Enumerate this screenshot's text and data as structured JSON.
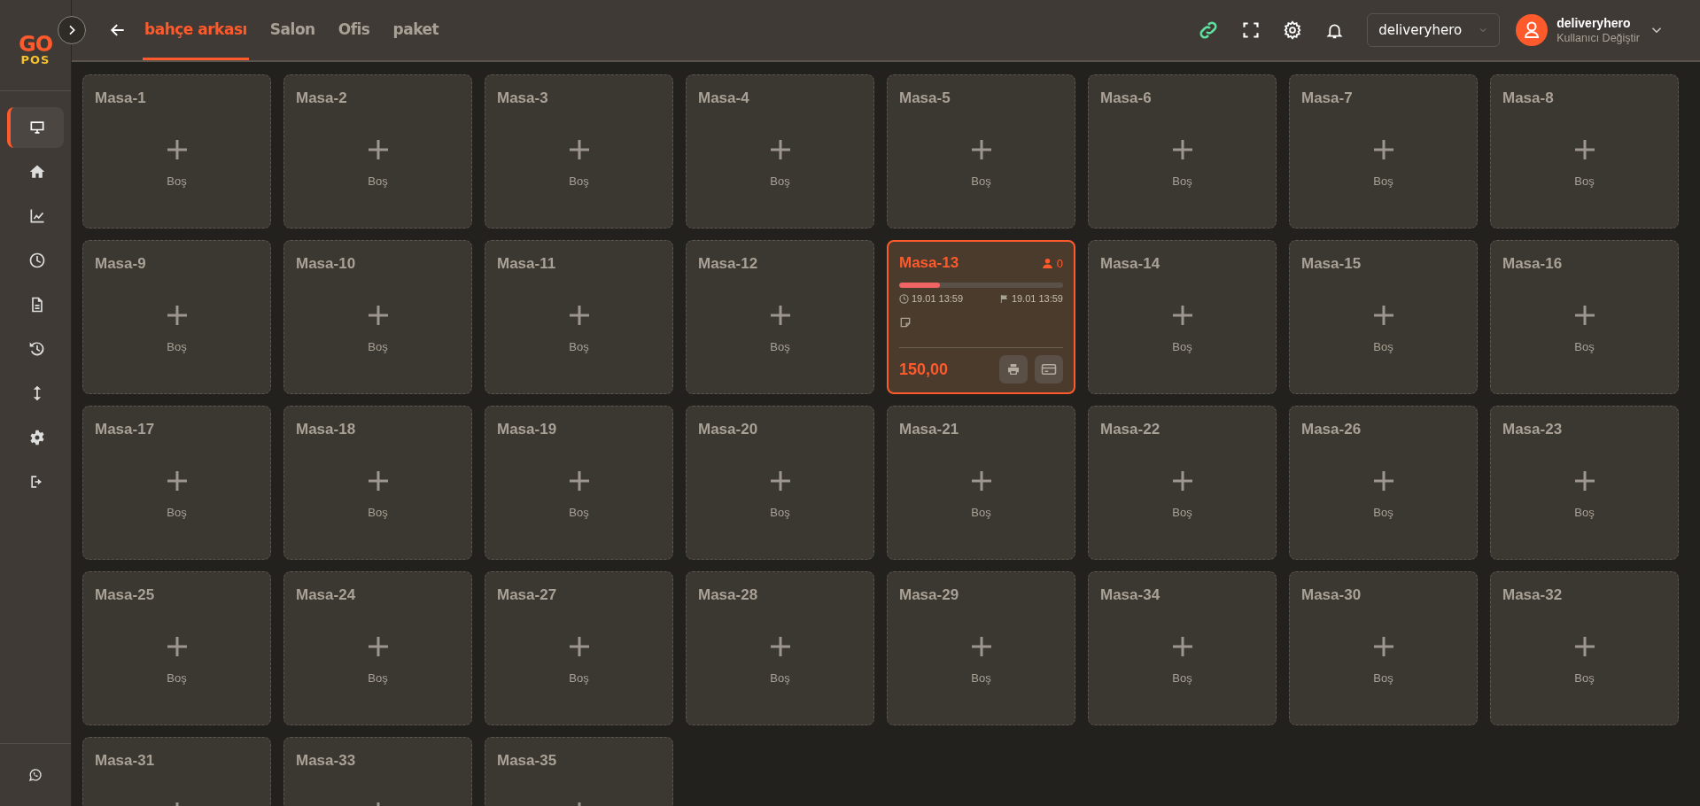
{
  "logo": {
    "top": "GO",
    "bottom": "POS"
  },
  "tabs": [
    {
      "label": "bahçe arkası",
      "selected": true
    },
    {
      "label": "Salon",
      "selected": false
    },
    {
      "label": "Ofis",
      "selected": false
    },
    {
      "label": "paket",
      "selected": false
    }
  ],
  "header": {
    "branch_select": "deliveryhero",
    "user": {
      "name": "deliveryhero",
      "subtitle": "Kullanıcı Değiştir"
    }
  },
  "sidebar": {
    "items": [
      {
        "kind": "monitor",
        "selected": true
      },
      {
        "kind": "home",
        "selected": false
      },
      {
        "kind": "chart",
        "selected": false
      },
      {
        "kind": "clock",
        "selected": false
      },
      {
        "kind": "document",
        "selected": false
      },
      {
        "kind": "history",
        "selected": false
      },
      {
        "kind": "updown",
        "selected": false
      },
      {
        "kind": "gear",
        "selected": false
      },
      {
        "kind": "logout",
        "selected": false
      }
    ]
  },
  "tables": [
    {
      "kind": "empty",
      "name": "Masa-1",
      "status": "Boş"
    },
    {
      "kind": "empty",
      "name": "Masa-2",
      "status": "Boş"
    },
    {
      "kind": "empty",
      "name": "Masa-3",
      "status": "Boş"
    },
    {
      "kind": "empty",
      "name": "Masa-4",
      "status": "Boş"
    },
    {
      "kind": "empty",
      "name": "Masa-5",
      "status": "Boş"
    },
    {
      "kind": "empty",
      "name": "Masa-6",
      "status": "Boş"
    },
    {
      "kind": "empty",
      "name": "Masa-7",
      "status": "Boş"
    },
    {
      "kind": "empty",
      "name": "Masa-8",
      "status": "Boş"
    },
    {
      "kind": "empty",
      "name": "Masa-9",
      "status": "Boş"
    },
    {
      "kind": "empty",
      "name": "Masa-10",
      "status": "Boş"
    },
    {
      "kind": "empty",
      "name": "Masa-11",
      "status": "Boş"
    },
    {
      "kind": "empty",
      "name": "Masa-12",
      "status": "Boş"
    },
    {
      "kind": "occupied",
      "name": "Masa-13",
      "guests": "0",
      "level": 0.25,
      "opened": "19.01 13:59",
      "target": "19.01 13:59",
      "total": "150,00"
    },
    {
      "kind": "empty",
      "name": "Masa-14",
      "status": "Boş"
    },
    {
      "kind": "empty",
      "name": "Masa-15",
      "status": "Boş"
    },
    {
      "kind": "empty",
      "name": "Masa-16",
      "status": "Boş"
    },
    {
      "kind": "empty",
      "name": "Masa-17",
      "status": "Boş"
    },
    {
      "kind": "empty",
      "name": "Masa-18",
      "status": "Boş"
    },
    {
      "kind": "empty",
      "name": "Masa-19",
      "status": "Boş"
    },
    {
      "kind": "empty",
      "name": "Masa-20",
      "status": "Boş"
    },
    {
      "kind": "empty",
      "name": "Masa-21",
      "status": "Boş"
    },
    {
      "kind": "empty",
      "name": "Masa-22",
      "status": "Boş"
    },
    {
      "kind": "empty",
      "name": "Masa-26",
      "status": "Boş"
    },
    {
      "kind": "empty",
      "name": "Masa-23",
      "status": "Boş"
    },
    {
      "kind": "empty",
      "name": "Masa-25",
      "status": "Boş"
    },
    {
      "kind": "empty",
      "name": "Masa-24",
      "status": "Boş"
    },
    {
      "kind": "empty",
      "name": "Masa-27",
      "status": "Boş"
    },
    {
      "kind": "empty",
      "name": "Masa-28",
      "status": "Boş"
    },
    {
      "kind": "empty",
      "name": "Masa-29",
      "status": "Boş"
    },
    {
      "kind": "empty",
      "name": "Masa-34",
      "status": "Boş"
    },
    {
      "kind": "empty",
      "name": "Masa-30",
      "status": "Boş"
    },
    {
      "kind": "empty",
      "name": "Masa-32",
      "status": "Boş"
    },
    {
      "kind": "empty",
      "name": "Masa-31"
    },
    {
      "kind": "empty",
      "name": "Masa-33"
    },
    {
      "kind": "empty",
      "name": "Masa-35"
    }
  ]
}
